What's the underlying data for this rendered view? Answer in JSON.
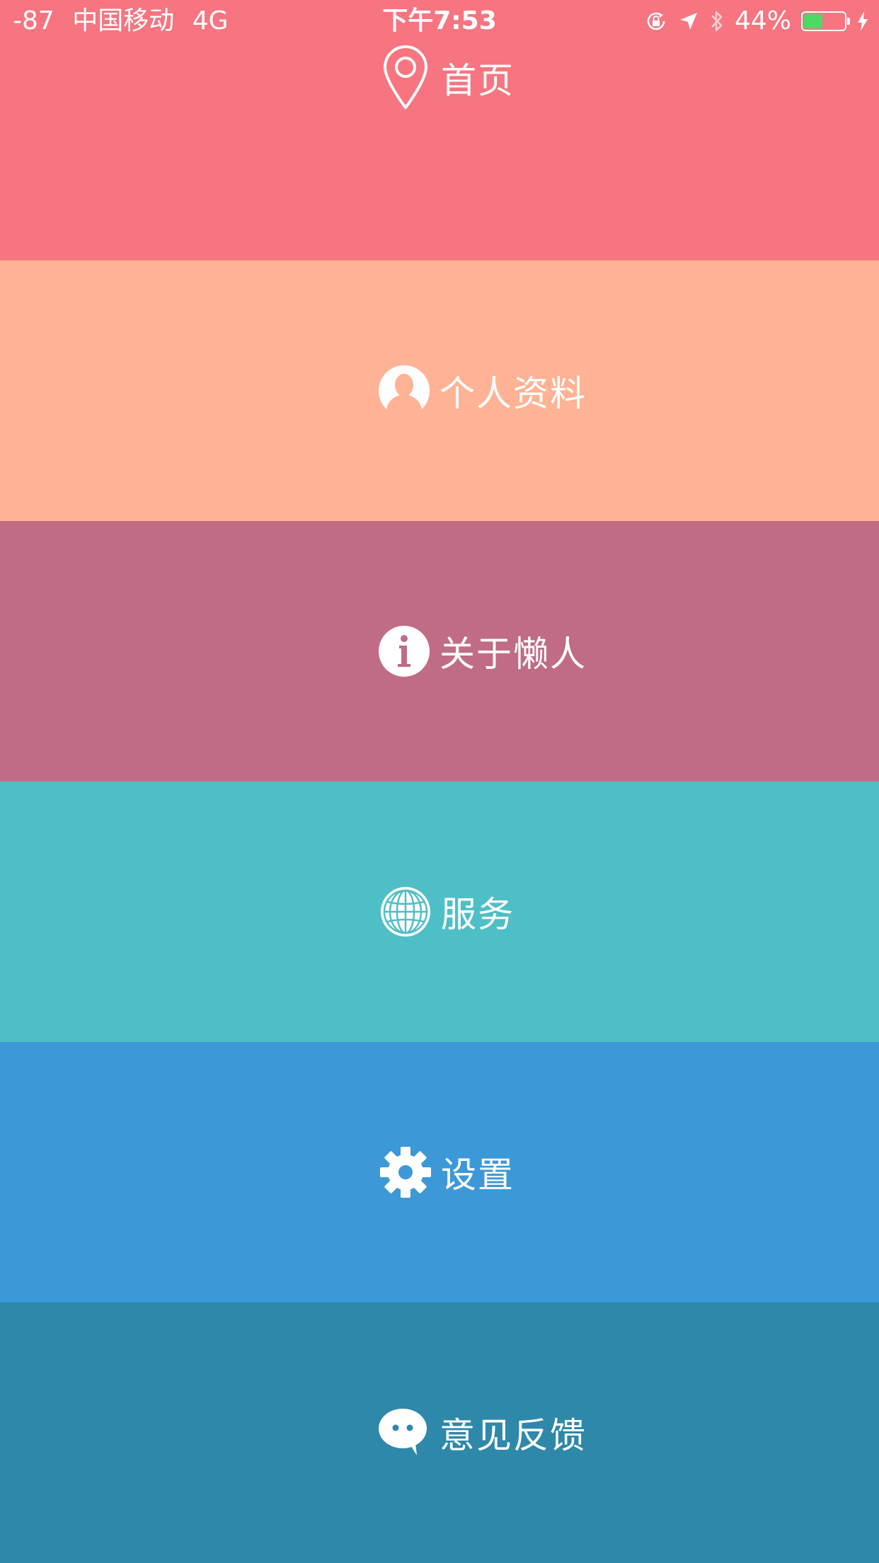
{
  "status_bar": {
    "signal": "-87",
    "carrier": "中国移动",
    "network": "4G",
    "time": "下午7:53",
    "battery_percent": "44%",
    "battery_level": 0.44,
    "icons": [
      "orientation-lock-icon",
      "location-arrow-icon",
      "bluetooth-icon",
      "battery-icon",
      "charging-bolt-icon"
    ]
  },
  "menu": {
    "items": [
      {
        "label": "首页",
        "icon": "map-pin-icon",
        "color": "#F67580"
      },
      {
        "label": "个人资料",
        "icon": "user-avatar-icon",
        "color": "#FFB394"
      },
      {
        "label": "关于懒人",
        "icon": "info-icon",
        "color": "#C06C84"
      },
      {
        "label": "服务",
        "icon": "globe-icon",
        "color": "#4FBFC7"
      },
      {
        "label": "设置",
        "icon": "gear-icon",
        "color": "#3D98D8"
      },
      {
        "label": "意见反馈",
        "icon": "chat-bubble-icon",
        "color": "#2E88AA"
      }
    ]
  }
}
